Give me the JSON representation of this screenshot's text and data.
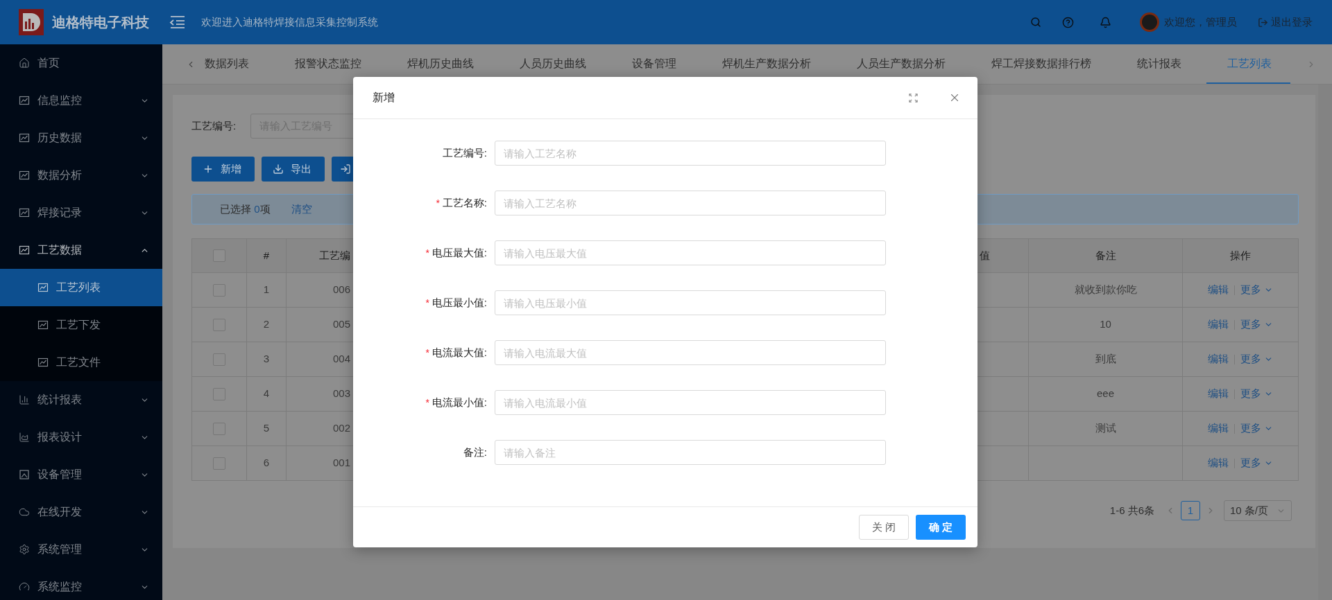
{
  "header": {
    "brand": "迪格特电子科技",
    "welcome_banner": "欢迎进入迪格特焊接信息采集控制系统",
    "user_greeting": "欢迎您，管理员",
    "logout": "退出登录"
  },
  "sidebar": {
    "items": [
      {
        "label": "首页",
        "kind": "link"
      },
      {
        "label": "信息监控",
        "kind": "group",
        "expanded": false
      },
      {
        "label": "历史数据",
        "kind": "group",
        "expanded": false
      },
      {
        "label": "数据分析",
        "kind": "group",
        "expanded": false
      },
      {
        "label": "焊接记录",
        "kind": "group",
        "expanded": false
      },
      {
        "label": "工艺数据",
        "kind": "group",
        "expanded": true,
        "children": [
          {
            "label": "工艺列表",
            "selected": true
          },
          {
            "label": "工艺下发",
            "selected": false
          },
          {
            "label": "工艺文件",
            "selected": false
          }
        ]
      },
      {
        "label": "统计报表",
        "kind": "group",
        "expanded": false
      },
      {
        "label": "报表设计",
        "kind": "group",
        "expanded": false
      },
      {
        "label": "设备管理",
        "kind": "group",
        "expanded": false
      },
      {
        "label": "在线开发",
        "kind": "group",
        "expanded": false
      },
      {
        "label": "系统管理",
        "kind": "group",
        "expanded": false
      },
      {
        "label": "系统监控",
        "kind": "group",
        "expanded": false
      }
    ]
  },
  "tabs": [
    {
      "label": "数据列表",
      "selected": false
    },
    {
      "label": "报警状态监控",
      "selected": false
    },
    {
      "label": "焊机历史曲线",
      "selected": false
    },
    {
      "label": "人员历史曲线",
      "selected": false
    },
    {
      "label": "设备管理",
      "selected": false
    },
    {
      "label": "焊机生产数据分析",
      "selected": false
    },
    {
      "label": "人员生产数据分析",
      "selected": false
    },
    {
      "label": "焊工焊接数据排行榜",
      "selected": false
    },
    {
      "label": "统计报表",
      "selected": false
    },
    {
      "label": "工艺列表",
      "selected": true
    }
  ],
  "filter": {
    "label": "工艺编号:",
    "placeholder": "请输入工艺编号"
  },
  "toolbar": {
    "buttons": [
      {
        "kind": "add",
        "label": "新增"
      },
      {
        "kind": "export",
        "label": "导出"
      },
      {
        "kind": "import"
      }
    ]
  },
  "selection_alert": {
    "prefix": "已选择 ",
    "count": "0",
    "suffix": "项",
    "clear": "清空"
  },
  "table": {
    "columns": [
      {
        "kind": "checkbox",
        "checked": false
      },
      {
        "kind": "text",
        "label": "#"
      },
      {
        "kind": "text",
        "label": "工艺编"
      },
      {
        "kind": "text",
        "label": "值"
      },
      {
        "kind": "text",
        "label": "备注"
      },
      {
        "kind": "text",
        "label": "操作"
      }
    ],
    "rows": [
      {
        "checked": false,
        "index": "1",
        "code": "006",
        "remark": "就收到款你吃",
        "actions": [
          "编辑",
          "更多"
        ]
      },
      {
        "checked": false,
        "index": "2",
        "code": "005",
        "remark": "10",
        "actions": [
          "编辑",
          "更多"
        ]
      },
      {
        "checked": false,
        "index": "3",
        "code": "004",
        "remark": "到底",
        "actions": [
          "编辑",
          "更多"
        ]
      },
      {
        "checked": false,
        "index": "4",
        "code": "003",
        "remark": "eee",
        "actions": [
          "编辑",
          "更多"
        ]
      },
      {
        "checked": false,
        "index": "5",
        "code": "002",
        "remark": "测试",
        "actions": [
          "编辑",
          "更多"
        ]
      },
      {
        "checked": false,
        "index": "6",
        "code": "001",
        "actions": [
          "编辑",
          "更多"
        ]
      }
    ]
  },
  "pagination": {
    "summary": "1-6 共6条",
    "pages": [
      {
        "label": "1",
        "selected": true
      }
    ],
    "page_size": "10 条/页"
  },
  "dialog": {
    "title": "新增",
    "fields": [
      {
        "label": "工艺编号:",
        "placeholder": "请输入工艺名称"
      },
      {
        "label": "工艺名称:",
        "required_mark": "*",
        "placeholder": "请输入工艺名称"
      },
      {
        "label": "电压最大值:",
        "required_mark": "*",
        "placeholder": "请输入电压最大值"
      },
      {
        "label": "电压最小值:",
        "required_mark": "*",
        "placeholder": "请输入电压最小值"
      },
      {
        "label": "电流最大值:",
        "required_mark": "*",
        "placeholder": "请输入电流最大值"
      },
      {
        "label": "电流最小值:",
        "required_mark": "*",
        "placeholder": "请输入电流最小值"
      },
      {
        "label": "备注:",
        "placeholder": "请输入备注"
      }
    ],
    "buttons": [
      {
        "kind": "default",
        "label": "关 闭"
      },
      {
        "kind": "primary",
        "label": "确 定"
      }
    ]
  }
}
